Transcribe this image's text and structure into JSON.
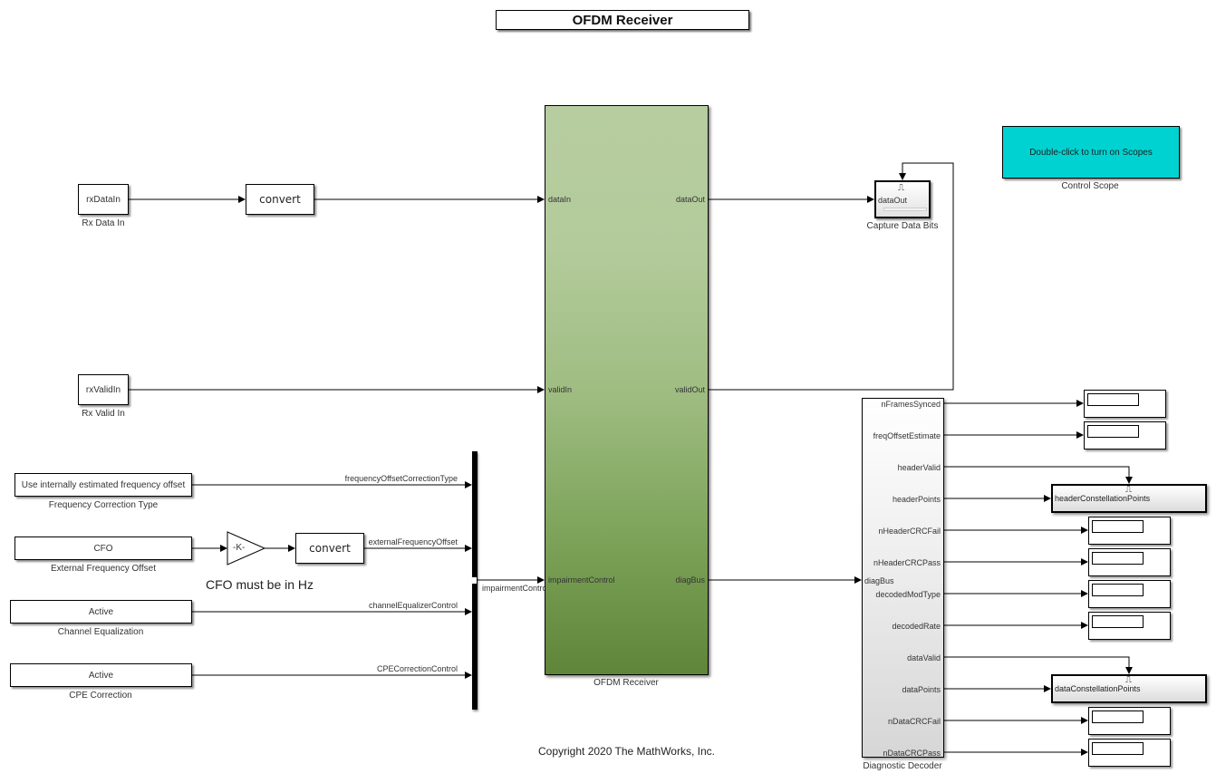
{
  "title": "OFDM Receiver",
  "copyright": "Copyright 2020 The MathWorks, Inc.",
  "note": "CFO must be in Hz",
  "colors": {
    "receiver_top": "#b7cda0",
    "receiver_bottom": "#5f8539",
    "control_scope": "#00d2d2",
    "wire": "#000000"
  },
  "inputs": {
    "rx_data": {
      "text": "rxDataIn",
      "label": "Rx Data In"
    },
    "rx_valid": {
      "text": "rxValidIn",
      "label": "Rx Valid In"
    }
  },
  "convert_label": "convert",
  "gain_label": "-K-",
  "constants": [
    {
      "value": "Use internally estimated frequency offset",
      "label": "Frequency Correction Type",
      "signal": "frequencyOffsetCorrectionType"
    },
    {
      "value": "CFO",
      "label": "External Frequency Offset",
      "signal": "externalFrequencyOffset"
    },
    {
      "value": "Active",
      "label": "Channel Equalization",
      "signal": "channelEqualizerControl"
    },
    {
      "value": "Active",
      "label": "CPE Correction",
      "signal": "CPECorrectionControl"
    }
  ],
  "bus_output_signal": "impairmentControl",
  "receiver": {
    "label": "OFDM Receiver",
    "in_ports": [
      "dataIn",
      "validIn",
      "impairmentControl"
    ],
    "out_ports": [
      "dataOut",
      "validOut",
      "diagBus"
    ]
  },
  "capture": {
    "port": "dataOut",
    "label": "Capture Data Bits"
  },
  "control_scope": {
    "text": "Double-click to turn on Scopes",
    "label": "Control Scope"
  },
  "decoder": {
    "label": "Diagnostic Decoder",
    "in_port": "diagBus",
    "out_ports": [
      "nFramesSynced",
      "freqOffsetEstimate",
      "headerValid",
      "headerPoints",
      "nHeaderCRCFail",
      "nHeaderCRCPass",
      "decodedModType",
      "decodedRate",
      "dataValid",
      "dataPoints",
      "nDataCRCFail",
      "nDataCRCPass"
    ]
  },
  "scopes": {
    "header": "headerConstellationPoints",
    "data": "dataConstellationPoints"
  }
}
